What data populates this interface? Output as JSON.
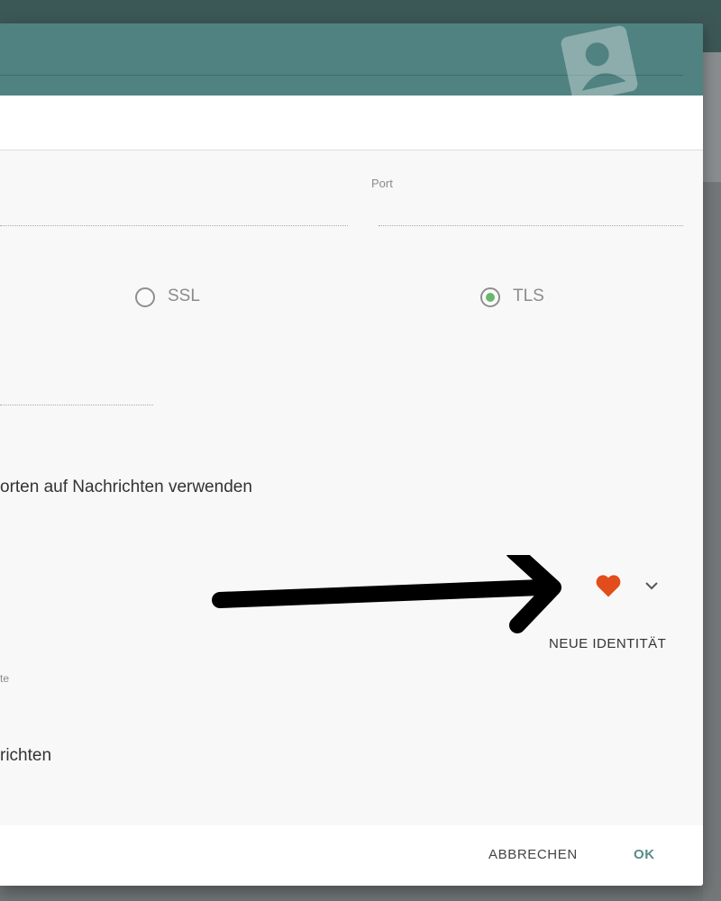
{
  "colors": {
    "header": "#4f8280",
    "radio_selected": "#67b96a",
    "heart": "#e24e1b",
    "ok_button": "#5a8c8a"
  },
  "icons": {
    "header_badge": "person-badge-icon",
    "identity": "heart-icon",
    "dropdown": "chevron-down-icon",
    "annotation": "arrow-icon"
  },
  "form": {
    "port_label": "Port",
    "security_options": [
      {
        "label": "SSL",
        "selected": false
      },
      {
        "label": "TLS",
        "selected": true
      }
    ],
    "reply_text": "orten auf Nachrichten verwenden",
    "small_caption": "te",
    "messages_text": "richten"
  },
  "identity": {
    "new_identity_label": "NEUE IDENTITÄT"
  },
  "footer": {
    "cancel_label": "ABBRECHEN",
    "ok_label": "OK"
  }
}
